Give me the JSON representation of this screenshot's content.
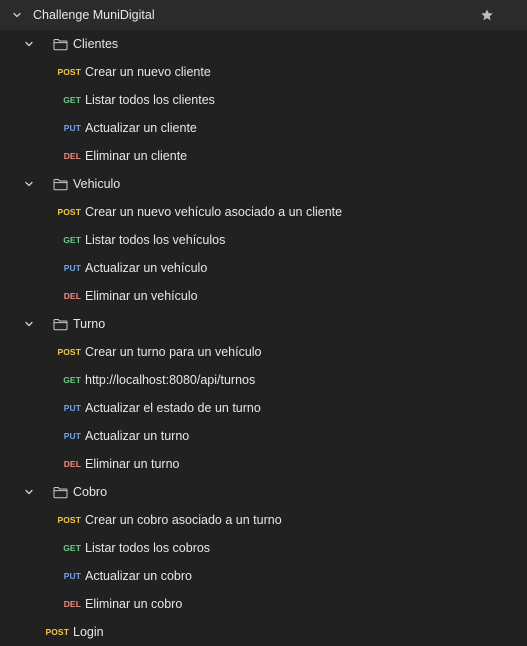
{
  "collection": {
    "name": "Challenge MuniDigital",
    "star_icon": "star-icon",
    "expand_icon": "chevron-down-icon"
  },
  "folders": [
    {
      "name": "Clientes",
      "requests": [
        {
          "method": "POST",
          "name": "Crear un nuevo cliente"
        },
        {
          "method": "GET",
          "name": "Listar todos los clientes"
        },
        {
          "method": "PUT",
          "name": "Actualizar un cliente"
        },
        {
          "method": "DEL",
          "name": "Eliminar un cliente"
        }
      ]
    },
    {
      "name": "Vehiculo",
      "requests": [
        {
          "method": "POST",
          "name": "Crear un nuevo vehículo asociado a un cliente"
        },
        {
          "method": "GET",
          "name": "Listar todos los vehículos"
        },
        {
          "method": "PUT",
          "name": "Actualizar un vehículo"
        },
        {
          "method": "DEL",
          "name": "Eliminar un vehículo"
        }
      ]
    },
    {
      "name": "Turno",
      "requests": [
        {
          "method": "POST",
          "name": "Crear un turno para un vehículo"
        },
        {
          "method": "GET",
          "name": "http://localhost:8080/api/turnos"
        },
        {
          "method": "PUT",
          "name": "Actualizar el estado de un turno"
        },
        {
          "method": "PUT",
          "name": "Actualizar un turno"
        },
        {
          "method": "DEL",
          "name": "Eliminar un turno"
        }
      ]
    },
    {
      "name": "Cobro",
      "requests": [
        {
          "method": "POST",
          "name": "Crear un cobro asociado a un turno"
        },
        {
          "method": "GET",
          "name": "Listar todos los cobros"
        },
        {
          "method": "PUT",
          "name": "Actualizar un cobro"
        },
        {
          "method": "DEL",
          "name": "Eliminar un cobro"
        }
      ]
    }
  ],
  "root_requests": [
    {
      "method": "POST",
      "name": "Login"
    }
  ],
  "colors": {
    "background": "#212121",
    "collection_row": "#2b2b2b",
    "post": "#f2c94c",
    "get": "#6bcb8b",
    "put": "#6fa3e8",
    "del": "#f08a7e"
  }
}
